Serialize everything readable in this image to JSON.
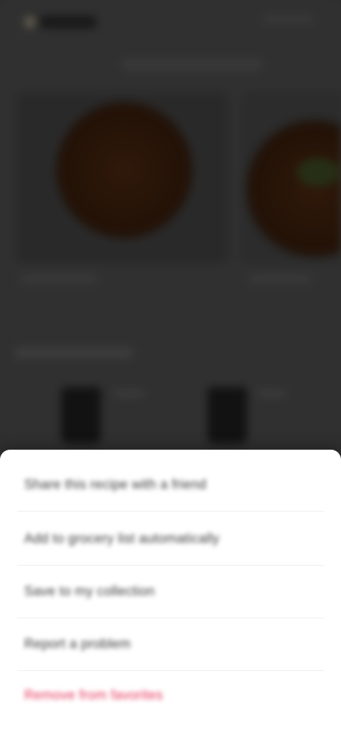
{
  "sheet": {
    "options": [
      {
        "label": "Share this recipe with a friend"
      },
      {
        "label": "Add to grocery list automatically"
      },
      {
        "label": "Save to my collection"
      },
      {
        "label": "Report a problem"
      },
      {
        "label": "Remove from favorites"
      }
    ]
  },
  "colors": {
    "danger": "#e6355a",
    "scrim": "#3b3b3b"
  }
}
